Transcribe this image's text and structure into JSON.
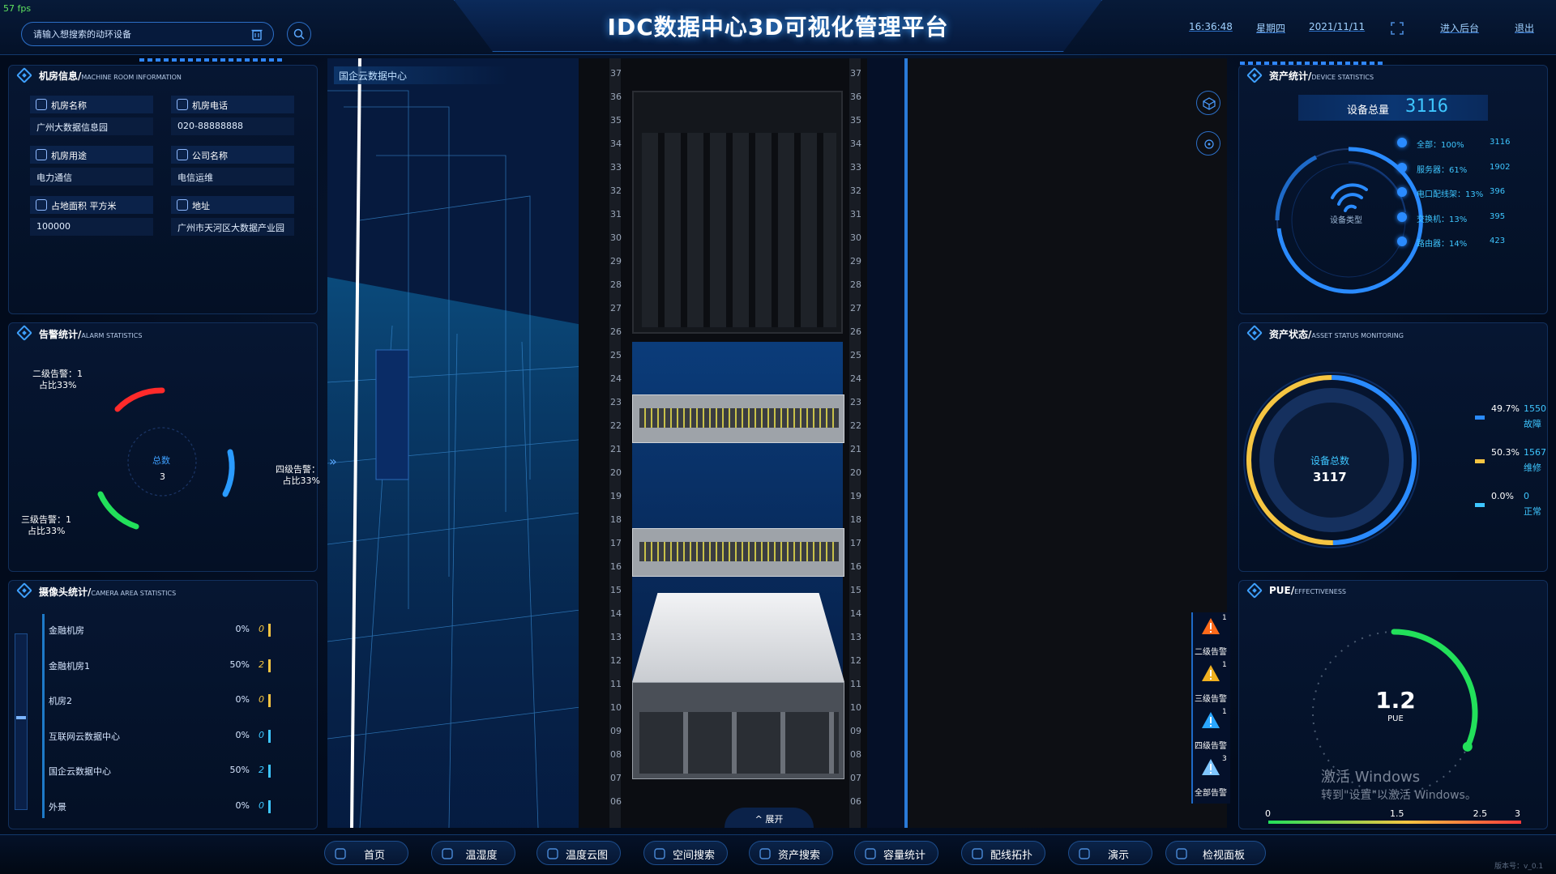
{
  "fps": "57 fps",
  "title": "IDC数据中心3D可视化管理平台",
  "search": {
    "placeholder": "请输入想搜索的动环设备"
  },
  "header": {
    "time": "16:36:48",
    "weekday": "星期四",
    "date": "2021/11/11",
    "admin_link": "进入后台",
    "logout_link": "退出"
  },
  "room_info": {
    "title": "机房信息/",
    "subtitle": "MACHINE ROOM INFORMATION",
    "fields": [
      {
        "label": "机房名称",
        "value": "广州大数据信息园",
        "icon": "home-icon"
      },
      {
        "label": "机房电话",
        "value": "020-88888888",
        "icon": "phone-icon"
      },
      {
        "label": "机房用途",
        "value": "电力通信",
        "icon": "purpose-icon"
      },
      {
        "label": "公司名称",
        "value": "电信运维",
        "icon": "building-icon"
      },
      {
        "label": "占地面积 平方米",
        "value": "100000",
        "icon": "area-icon"
      },
      {
        "label": "地址",
        "value": "广州市天河区大数据产业园",
        "icon": "location-icon"
      }
    ]
  },
  "alarm_stats": {
    "title": "告警统计/",
    "subtitle": "ALARM STATISTICS",
    "total_label": "总数",
    "total": "3",
    "items": [
      {
        "name": "二级告警：1",
        "ratio": "占比33%",
        "count": 1,
        "percent": 33,
        "color": "#ff2a2a"
      },
      {
        "name": "四级告警：",
        "ratio": "占比33%",
        "count": 1,
        "percent": 33,
        "color": "#2a9bff"
      },
      {
        "name": "三级告警：1",
        "ratio": "占比33%",
        "count": 1,
        "percent": 33,
        "color": "#22e05a"
      }
    ]
  },
  "camera_stats": {
    "title": "摄像头统计/",
    "subtitle": "CAMERA AREA STATISTICS",
    "rows": [
      {
        "name": "金融机房",
        "percent": "0%",
        "count": "0",
        "color": "#f5c542"
      },
      {
        "name": "金融机房1",
        "percent": "50%",
        "count": "2",
        "color": "#f5c542"
      },
      {
        "name": "机房2",
        "percent": "0%",
        "count": "0",
        "color": "#f5c542"
      },
      {
        "name": "互联网云数据中心",
        "percent": "0%",
        "count": "0",
        "color": "#3ec6ff"
      },
      {
        "name": "国企云数据中心",
        "percent": "50%",
        "count": "2",
        "color": "#3ec6ff"
      },
      {
        "name": "外景",
        "percent": "0%",
        "count": "0",
        "color": "#3ec6ff"
      }
    ]
  },
  "viewport": {
    "title": "国企云数据中心",
    "expand_label": "展开",
    "rack_numbers": [
      "37",
      "36",
      "35",
      "34",
      "33",
      "32",
      "31",
      "30",
      "29",
      "28",
      "27",
      "26",
      "25",
      "24",
      "23",
      "22",
      "21",
      "20",
      "19",
      "18",
      "17",
      "16",
      "15",
      "14",
      "13",
      "12",
      "11",
      "10",
      "09",
      "08",
      "07",
      "06"
    ]
  },
  "side_alarms": [
    {
      "label": "二级告警",
      "count": "1",
      "color": "#ff6a1a"
    },
    {
      "label": "三级告警",
      "count": "1",
      "color": "#f0b020"
    },
    {
      "label": "四级告警",
      "count": "1",
      "color": "#2aa6ff"
    },
    {
      "label": "全部告警",
      "count": "3",
      "color": "#7fc6ff"
    }
  ],
  "asset_stats": {
    "title": "资产统计/",
    "subtitle": "DEVICE STATISTICS",
    "total_label": "设备总量",
    "total": "3116",
    "center_label": "设备类型",
    "legend": [
      {
        "name": "全部：100%",
        "count": "3116"
      },
      {
        "name": "服务器：61%",
        "count": "1902"
      },
      {
        "name": "电口配线架：13%",
        "count": "396"
      },
      {
        "name": "交换机：13%",
        "count": "395"
      },
      {
        "name": "路由器：14%",
        "count": "423"
      }
    ]
  },
  "asset_status": {
    "title": "资产状态/",
    "subtitle": "ASSET STATUS MONITORING",
    "center_label": "设备总数",
    "total": "3117",
    "items": [
      {
        "percent": "49.7%",
        "count": "1550",
        "name": "故障",
        "value": 49.7,
        "color": "#2a8bff"
      },
      {
        "percent": "50.3%",
        "count": "1567",
        "name": "维修",
        "value": 50.3,
        "color": "#f5c542"
      },
      {
        "percent": "0.0%",
        "count": "0",
        "name": "正常",
        "value": 0,
        "color": "#3ec6ff"
      }
    ]
  },
  "pue": {
    "title": "PUE/",
    "subtitle": "EFFECTIVENESS",
    "value": "1.2",
    "unit": "PUE",
    "value_num": 1.2,
    "scale": [
      "0",
      "1.5",
      "2.5",
      "3"
    ]
  },
  "watermark": {
    "line1": "激活 Windows",
    "line2": "转到\"设置\"以激活 Windows。"
  },
  "version": "版本号：v_0.1",
  "nav": [
    {
      "label": "首页",
      "icon": "home-icon"
    },
    {
      "label": "温湿度",
      "icon": "thermometer-icon"
    },
    {
      "label": "温度云图",
      "icon": "cloud-icon"
    },
    {
      "label": "空间搜索",
      "icon": "space-search-icon"
    },
    {
      "label": "资产搜索",
      "icon": "asset-search-icon"
    },
    {
      "label": "容量统计",
      "icon": "pie-icon"
    },
    {
      "label": "配线拓扑",
      "icon": "topology-icon"
    },
    {
      "label": "演示",
      "icon": "presentation-icon"
    },
    {
      "label": "检视面板",
      "icon": "panel-icon"
    }
  ]
}
